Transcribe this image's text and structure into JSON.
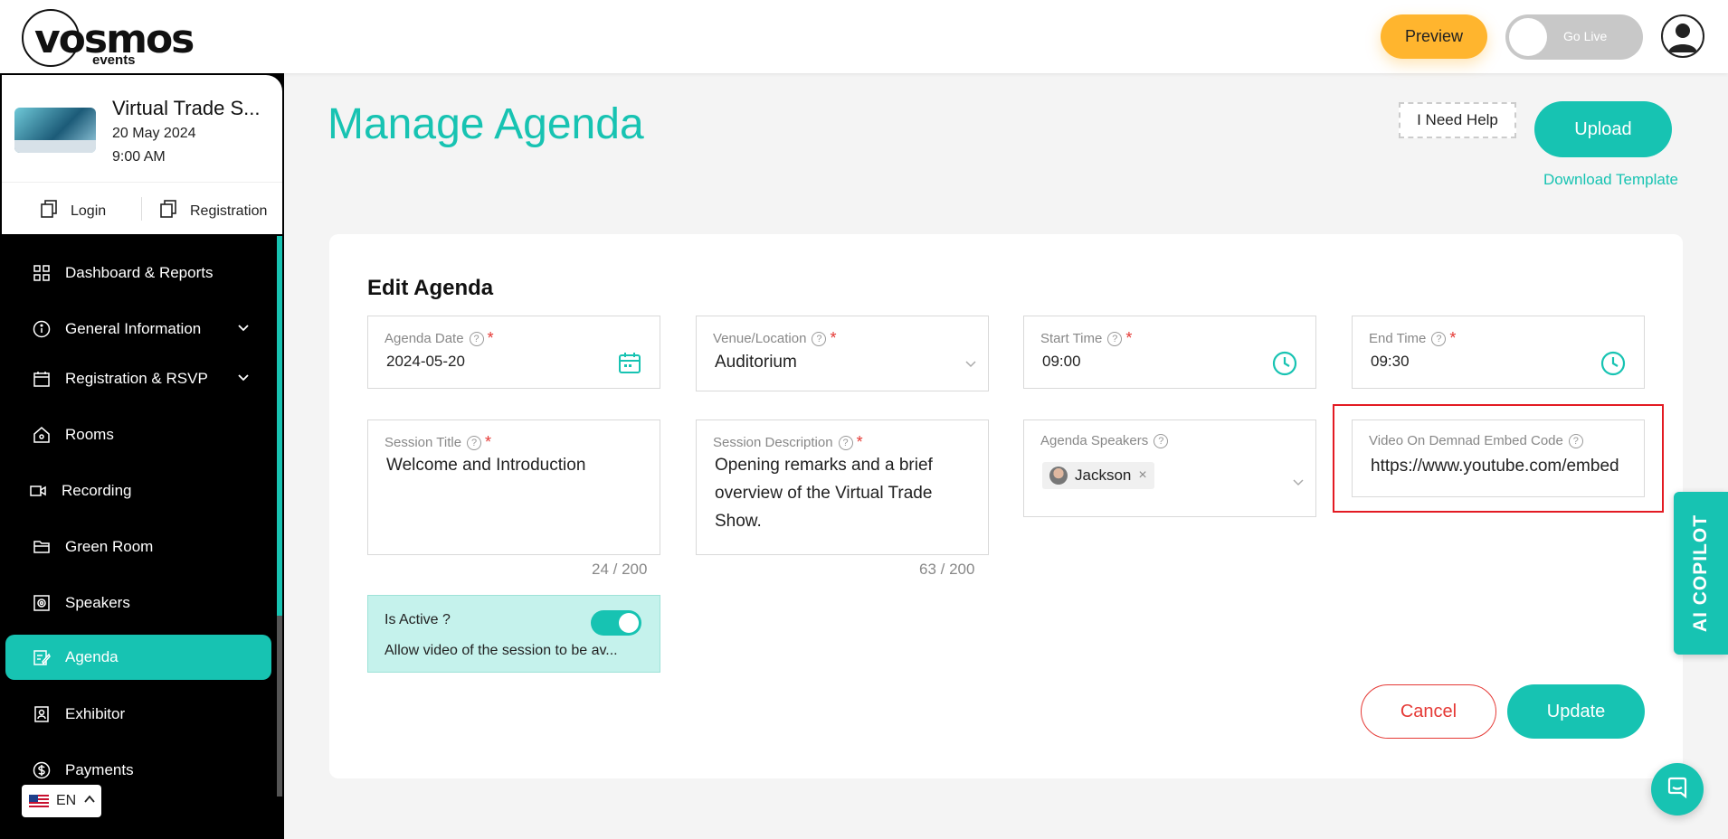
{
  "header": {
    "logo_text": "vosmos",
    "logo_sub": "events",
    "preview_label": "Preview",
    "golive_label": "Go Live"
  },
  "event": {
    "title": "Virtual Trade S...",
    "date": "20 May 2024",
    "time": "9:00 AM",
    "login_label": "Login",
    "registration_label": "Registration"
  },
  "sidebar": {
    "items": [
      {
        "label": "Dashboard & Reports",
        "icon": "grid-icon"
      },
      {
        "label": "General Information",
        "icon": "info-icon"
      },
      {
        "label": "Registration & RSVP",
        "icon": "calendar-icon"
      },
      {
        "label": "Rooms",
        "icon": "home-icon"
      },
      {
        "label": "Recording",
        "icon": "video-icon"
      },
      {
        "label": "Green Room",
        "icon": "folder-icon"
      },
      {
        "label": "Speakers",
        "icon": "speaker-icon"
      },
      {
        "label": "Agenda",
        "icon": "edit-icon"
      },
      {
        "label": "Exhibitor",
        "icon": "badge-icon"
      },
      {
        "label": "Payments",
        "icon": "dollar-icon"
      }
    ],
    "active_item": "Agenda",
    "language": "EN"
  },
  "page": {
    "title": "Manage Agenda",
    "help_label": "I Need Help",
    "upload_label": "Upload",
    "download_label": "Download Template"
  },
  "form": {
    "title": "Edit Agenda",
    "agenda_date": {
      "label": "Agenda Date",
      "value": "2024-05-20"
    },
    "venue": {
      "label": "Venue/Location",
      "value": "Auditorium"
    },
    "start_time": {
      "label": "Start Time",
      "value": "09:00"
    },
    "end_time": {
      "label": "End Time",
      "value": "09:30"
    },
    "session_title": {
      "label": "Session Title",
      "value": "Welcome and Introduction",
      "counter": "24 / 200"
    },
    "session_description": {
      "label": "Session Description",
      "value": "Opening remarks and a brief overview of the Virtual Trade Show.",
      "counter": "63 / 200"
    },
    "speakers": {
      "label": "Agenda Speakers",
      "selected": "Jackson"
    },
    "vod": {
      "label": "Video On Demnad Embed Code",
      "value": "https://www.youtube.com/embed"
    },
    "is_active": {
      "label": "Is Active ?",
      "description": "Allow video of the session to be av..."
    },
    "cancel_label": "Cancel",
    "update_label": "Update"
  },
  "copilot_label": "AI COPILOT",
  "colors": {
    "accent": "#17c3b2",
    "preview": "#ffb52e",
    "danger": "#e53935"
  }
}
